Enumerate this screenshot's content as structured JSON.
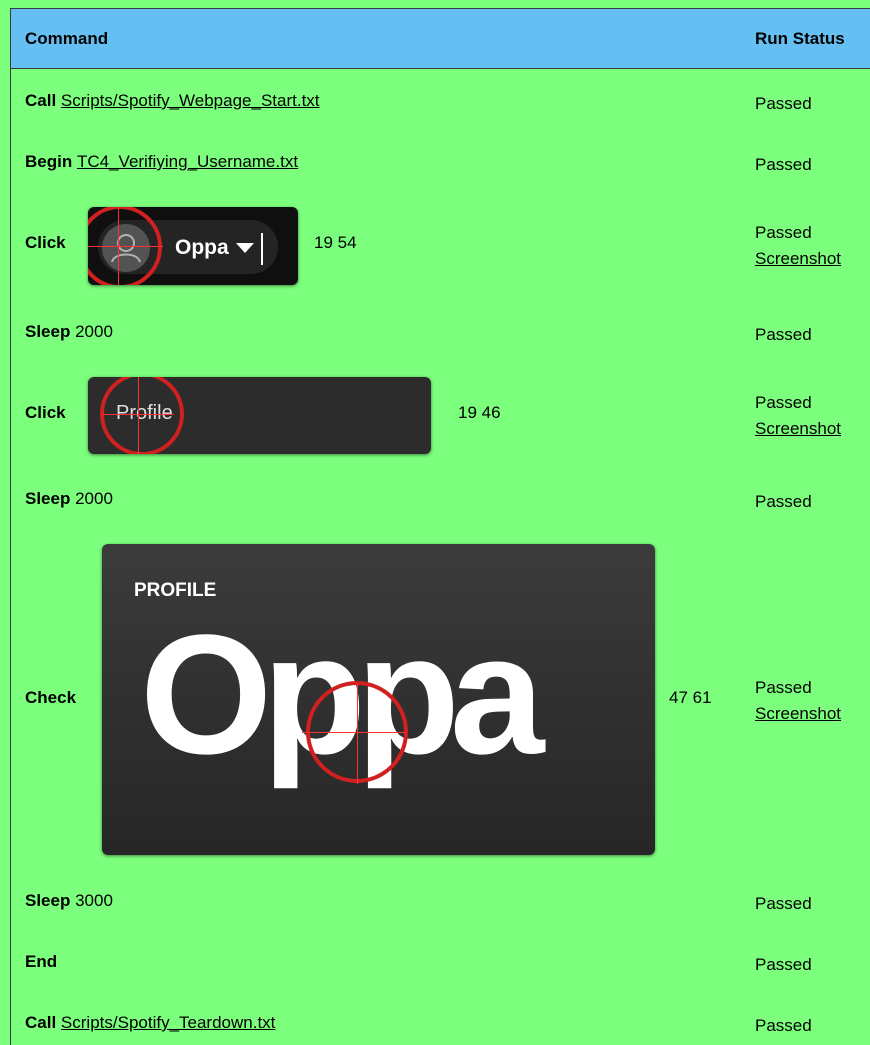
{
  "header": {
    "command": "Command",
    "run_status": "Run Status"
  },
  "rows": [
    {
      "keyword": "Call",
      "arg": "Scripts/Spotify_Webpage_Start.txt",
      "status": "Passed"
    },
    {
      "keyword": "Begin",
      "arg": "TC4_Verifiying_Username.txt",
      "status": "Passed"
    },
    {
      "keyword": "Click",
      "image_text": "Oppa",
      "coords": "19 54",
      "status": "Passed",
      "screenshot": "Screenshot"
    },
    {
      "keyword": "Sleep",
      "arg": "2000",
      "status": "Passed"
    },
    {
      "keyword": "Click",
      "image_text": "Profile",
      "coords": "19 46",
      "status": "Passed",
      "screenshot": "Screenshot"
    },
    {
      "keyword": "Sleep",
      "arg": "2000",
      "status": "Passed"
    },
    {
      "keyword": "Check",
      "image_label": "PROFILE",
      "image_text": "Oppa",
      "coords": "47 61",
      "status": "Passed",
      "screenshot": "Screenshot"
    },
    {
      "keyword": "Sleep",
      "arg": "3000",
      "status": "Passed"
    },
    {
      "keyword": "End",
      "status": "Passed"
    },
    {
      "keyword": "Call",
      "arg": "Scripts/Spotify_Teardown.txt",
      "status": "Passed"
    }
  ],
  "colors": {
    "row_bg": "#7cff7c",
    "header_bg": "#66bff2",
    "target": "#d02020"
  },
  "icons": {
    "user": "user-icon",
    "caret": "caret-down-icon"
  }
}
